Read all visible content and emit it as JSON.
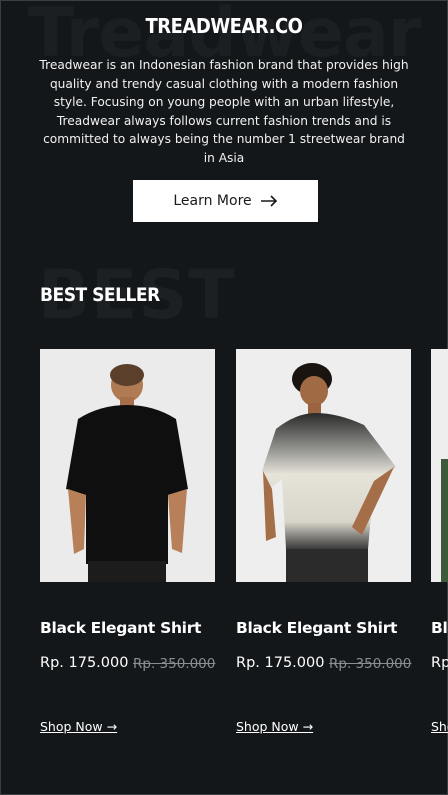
{
  "brand": {
    "watermark": "Treadwear",
    "title": "TREADWEAR.CO",
    "description": "Treadwear is an Indonesian fashion brand that provides high quality and trendy casual clothing with a modern fashion style. Focusing on young people with an urban lifestyle, Treadwear always follows current fashion trends and is committed to always being the number 1 streetwear brand in Asia",
    "button_label": "Learn More",
    "button_icon": "arrow-right-icon"
  },
  "best_seller": {
    "watermark": "BEST",
    "title": "BEST SELLER",
    "products": [
      {
        "name": "Black Elegant Shirt",
        "price": "Rp. 175.000",
        "old_price": "Rp. 350.000",
        "link": "Shop Now →",
        "image": "black-tshirt-back-photo"
      },
      {
        "name": "Black Elegant Shirt",
        "price": "Rp. 175.000",
        "old_price": "Rp. 350.000",
        "link": "Shop Now →",
        "image": "gradient-tshirt-front-photo"
      },
      {
        "name": "Bl",
        "price": "Rp",
        "link": "Sho",
        "image": "partial-product-photo"
      }
    ]
  },
  "colors": {
    "background": "#131719",
    "button": "#ffffff",
    "strike": "#8a8e90"
  }
}
